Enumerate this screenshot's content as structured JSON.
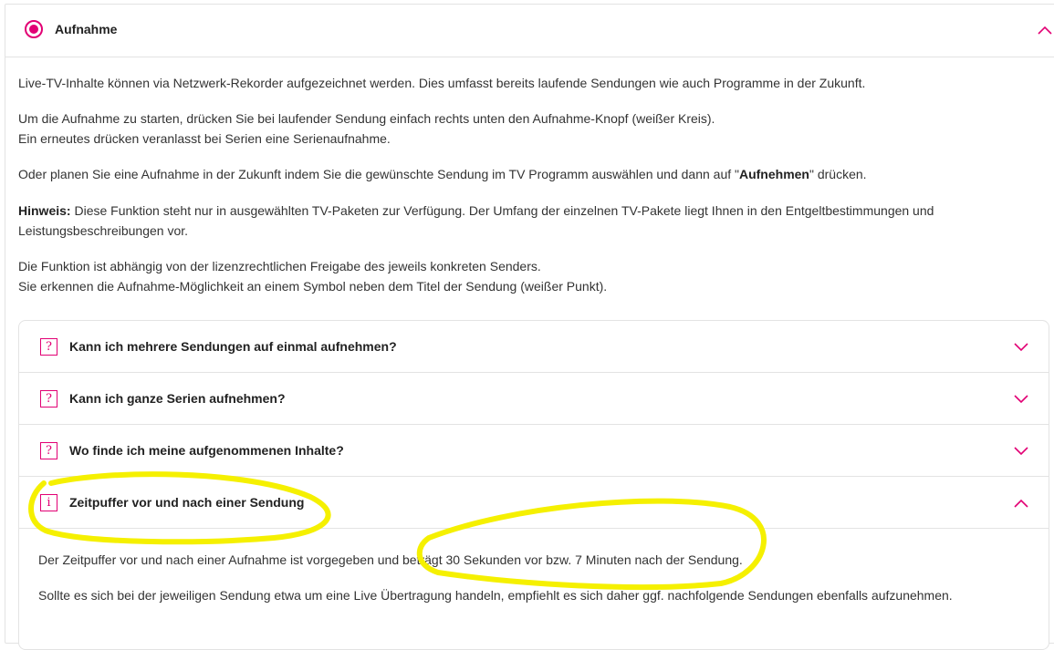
{
  "section": {
    "title": "Aufnahme",
    "intro": "Live-TV-Inhalte können via Netzwerk-Rekorder aufgezeichnet werden. Dies umfasst bereits laufende Sendungen wie auch Programme in der Zukunft.",
    "start_line1": "Um die Aufnahme zu starten, drücken Sie bei laufender Sendung einfach rechts unten den Aufnahme-Knopf (weißer Kreis).",
    "start_line2": "Ein erneutes drücken veranlasst bei Serien eine Serienaufnahme.",
    "plan_prefix": "Oder planen Sie eine Aufnahme in der Zukunft indem Sie die gewünschte Sendung im TV Programm auswählen und dann auf \"",
    "plan_bold": "Aufnehmen",
    "plan_suffix": "\" drücken.",
    "hint_label": "Hinweis:",
    "hint_text": " Diese Funktion steht nur in ausgewählten TV-Paketen zur Verfügung. Der Umfang der einzelnen TV-Pakete liegt Ihnen in den Entgeltbestimmungen und",
    "hint_line2": "Leistungsbeschreibungen vor.",
    "license_line1": "Die Funktion ist abhängig von der lizenzrechtlichen Freigabe des jeweils konkreten Senders.",
    "license_line2": "Sie erkennen die Aufnahme-Möglichkeit an einem Symbol neben dem Titel der Sendung (weißer Punkt)."
  },
  "faq": [
    {
      "icon": "?",
      "title": "Kann ich mehrere Sendungen auf einmal aufnehmen?",
      "expanded": false
    },
    {
      "icon": "?",
      "title": "Kann ich ganze Serien aufnehmen?",
      "expanded": false
    },
    {
      "icon": "?",
      "title": "Wo finde ich meine aufgenommenen Inhalte?",
      "expanded": false
    },
    {
      "icon": "i",
      "title": "Zeitpuffer vor und nach einer Sendung",
      "expanded": true
    }
  ],
  "answer": {
    "line1": "Der Zeitpuffer vor und nach einer Aufnahme ist vorgegeben und beträgt 30 Sekunden vor bzw. 7 Minuten nach der Sendung.",
    "line2": "Sollte es sich bei der jeweiligen Sendung etwa um eine Live Übertragung handeln, empfiehlt es sich daher ggf. nachfolgende Sendungen ebenfalls aufzunehmen."
  },
  "colors": {
    "accent": "#e20074",
    "highlight": "#f5f000"
  }
}
